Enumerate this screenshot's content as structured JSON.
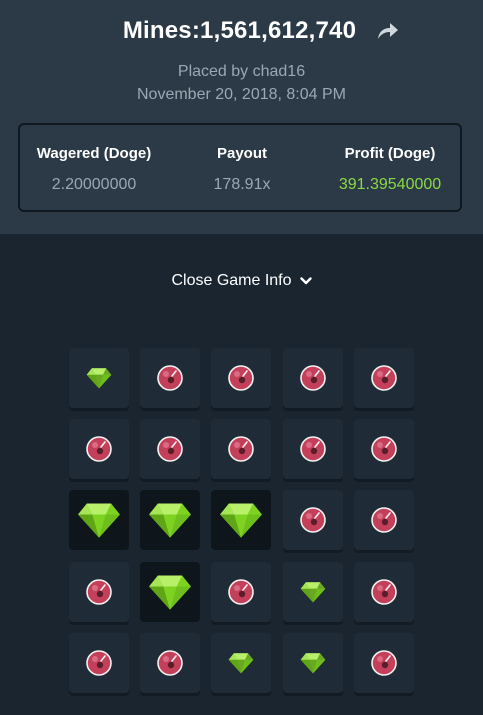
{
  "header": {
    "title": "Mines:1,561,612,740",
    "placed_by": "Placed by chad16",
    "date": "November 20, 2018, 8:04 PM"
  },
  "stats": {
    "wagered_label": "Wagered (Doge)",
    "wagered_value": "2.20000000",
    "payout_label": "Payout",
    "payout_value": "178.91x",
    "profit_label": "Profit (Doge)",
    "profit_value": "391.39540000"
  },
  "toggle_label": "Close Game Info",
  "colors": {
    "gem": "#7ed321",
    "mine": "#c4405a",
    "profit": "#8ad845"
  },
  "grid": {
    "rows": [
      [
        "gem-dim",
        "mine",
        "mine",
        "mine",
        "mine"
      ],
      [
        "mine",
        "mine",
        "mine",
        "mine",
        "mine"
      ],
      [
        "gem",
        "gem",
        "gem",
        "mine",
        "mine"
      ],
      [
        "mine",
        "gem",
        "mine",
        "gem-dim",
        "mine"
      ],
      [
        "mine",
        "mine",
        "gem-dim",
        "gem-dim",
        "mine"
      ]
    ]
  }
}
